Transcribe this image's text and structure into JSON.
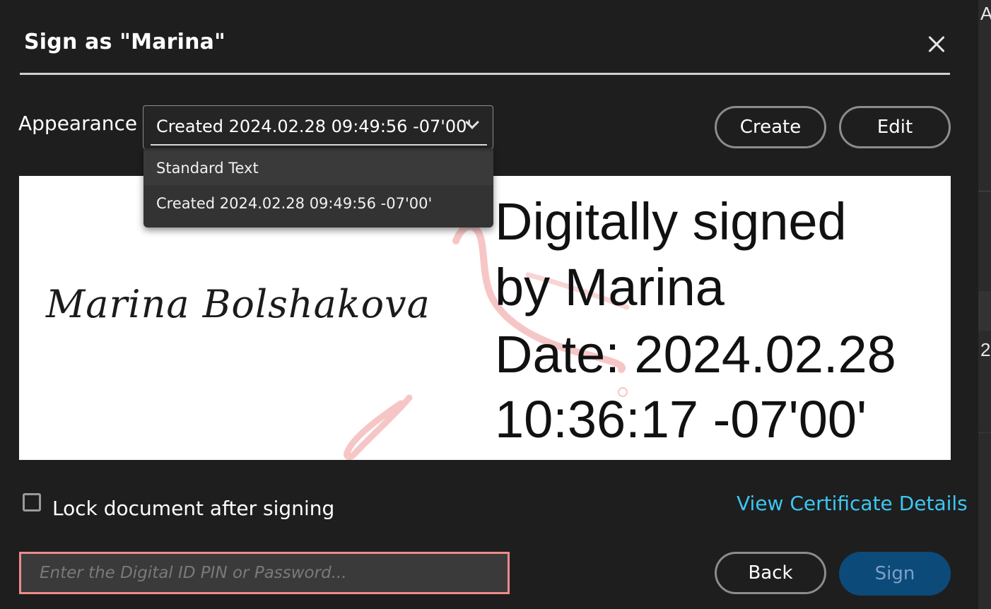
{
  "dialog": {
    "title": "Sign as \"Marina\"",
    "close_icon": "close-icon"
  },
  "appearance": {
    "label": "Appearance",
    "selected": "Created 2024.02.28 09:49:56 -07'00'",
    "chevron_icon": "chevron-down-icon",
    "options": [
      "Standard Text",
      "Created 2024.02.28 09:49:56 -07'00'"
    ]
  },
  "buttons": {
    "create": "Create",
    "edit": "Edit",
    "back": "Back",
    "sign": "Sign"
  },
  "preview": {
    "signature_name": "Marina Bolshakova",
    "lines": [
      "Digitally signed",
      "by Marina",
      "Date: 2024.02.28",
      "10:36:17 -07'00'"
    ]
  },
  "options": {
    "lock_label": "Lock document after signing",
    "lock_checked": false,
    "cert_link": "View Certificate Details"
  },
  "pin": {
    "placeholder": "Enter the Digital ID PIN or Password..."
  },
  "colors": {
    "background": "#1e1e1e",
    "link": "#3cc6f2",
    "sign_button": "#0c4a7a",
    "pin_border": "#f08a8a"
  },
  "backdrop": {
    "partial_glyph_top": "A",
    "partial_glyph_mid": "2"
  }
}
